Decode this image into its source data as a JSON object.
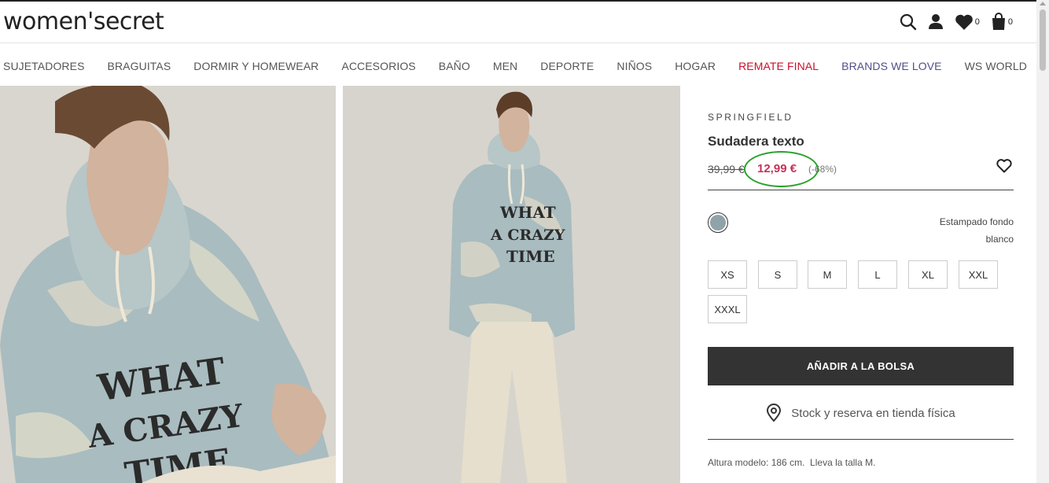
{
  "header": {
    "logo": "women'secret",
    "wishlist_count": "0",
    "cart_count": "0",
    "icons": [
      "search-icon",
      "user-icon",
      "heart-icon",
      "bag-icon"
    ]
  },
  "nav": {
    "items": [
      {
        "label": "SUJETADORES"
      },
      {
        "label": "BRAGUITAS"
      },
      {
        "label": "DORMIR Y HOMEWEAR"
      },
      {
        "label": "ACCESORIOS"
      },
      {
        "label": "BAÑO"
      },
      {
        "label": "MEN"
      },
      {
        "label": "DEPORTE"
      },
      {
        "label": "NIÑOS"
      },
      {
        "label": "HOGAR"
      },
      {
        "label": "REMATE FINAL"
      },
      {
        "label": "BRANDS WE LOVE"
      },
      {
        "label": "WS WORLD"
      }
    ]
  },
  "product": {
    "brand": "SPRINGFIELD",
    "name": "Sudadera texto",
    "old_price": "39,99 €",
    "price": "12,99 €",
    "discount": "(-68%)",
    "color_name": "Estampado fondo blanco",
    "sizes": [
      "XS",
      "S",
      "M",
      "L",
      "XL",
      "XXL",
      "XXXL"
    ],
    "add_to_bag": "AÑADIR A LA BOLSA",
    "store_stock": "Stock y reserva en tienda física",
    "model_info": "Altura modelo: 186 cm.  Lleva la talla M."
  },
  "colors": {
    "accent_red": "#c8102e",
    "price": "#c8305a",
    "annotation_circle": "#2aa02a",
    "button": "#333333",
    "swatch": "#8fa3a8"
  }
}
